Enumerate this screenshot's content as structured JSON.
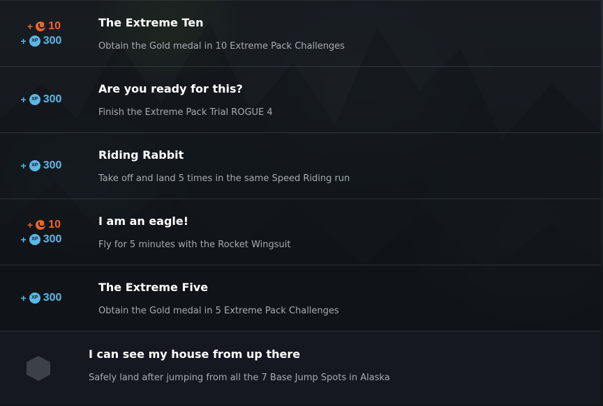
{
  "achievements": [
    {
      "title": "The Extreme Ten",
      "description": "Obtain the Gold medal in 10 Extreme Pack Challenges",
      "reward_coins": "10",
      "reward_xp": "300",
      "plus": "+",
      "xp_label": "XP"
    },
    {
      "title": "Are you ready for this?",
      "description": "Finish the Extreme Pack Trial ROGUE 4",
      "reward_xp": "300",
      "plus": "+",
      "xp_label": "XP"
    },
    {
      "title": "Riding Rabbit",
      "description": "Take off and land 5 times in the same Speed Riding run",
      "reward_xp": "300",
      "plus": "+",
      "xp_label": "XP"
    },
    {
      "title": "I am an eagle!",
      "description": "Fly for 5 minutes with the Rocket Wingsuit",
      "reward_coins": "10",
      "reward_xp": "300",
      "plus": "+",
      "xp_label": "XP"
    },
    {
      "title": "The Extreme Five",
      "description": "Obtain the Gold medal in 5 Extreme Pack Challenges",
      "reward_xp": "300",
      "plus": "+",
      "xp_label": "XP"
    },
    {
      "title": "I can see my house from up there",
      "description": "Safely land after jumping from all the 7 Base Jump Spots in Alaska",
      "badge_icon": "locked-hexagon-icon"
    }
  ],
  "colors": {
    "coin": "#e8672b",
    "xp": "#5cb8e6",
    "title": "#ffffff",
    "description": "#a7acb1",
    "badge": "#3b4147"
  }
}
